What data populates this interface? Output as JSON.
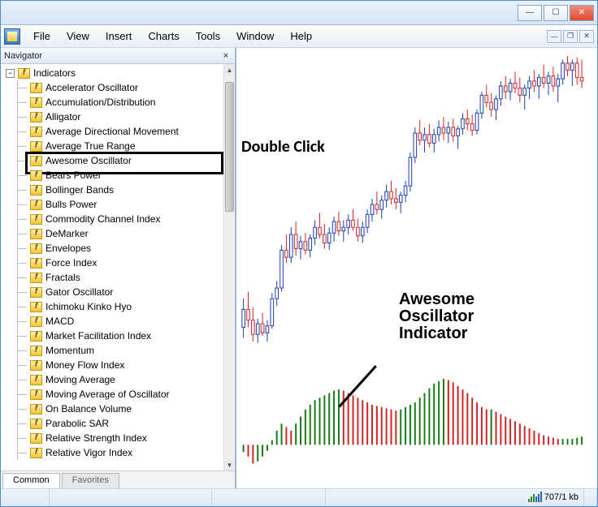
{
  "titlebar": {
    "min": "—",
    "max": "☐",
    "close": "✕"
  },
  "menu": {
    "items": [
      "File",
      "View",
      "Insert",
      "Charts",
      "Tools",
      "Window",
      "Help"
    ],
    "mdi": {
      "min": "—",
      "restore": "❐",
      "close": "✕"
    }
  },
  "navigator": {
    "title": "Navigator",
    "close": "×",
    "root": "Indicators",
    "items": [
      "Accelerator Oscillator",
      "Accumulation/Distribution",
      "Alligator",
      "Average Directional Movement",
      "Average True Range",
      "Awesome Oscillator",
      "Bears Power",
      "Bollinger Bands",
      "Bulls Power",
      "Commodity Channel Index",
      "DeMarker",
      "Envelopes",
      "Force Index",
      "Fractals",
      "Gator Oscillator",
      "Ichimoku Kinko Hyo",
      "MACD",
      "Market Facilitation Index",
      "Momentum",
      "Money Flow Index",
      "Moving Average",
      "Moving Average of Oscillator",
      "On Balance Volume",
      "Parabolic SAR",
      "Relative Strength Index",
      "Relative Vigor Index"
    ],
    "highlight_index": 5,
    "tabs": {
      "common": "Common",
      "favorites": "Favorites"
    }
  },
  "annotations": {
    "double_click": "Double Click",
    "indicator_line1": "Awesome",
    "indicator_line2": "Oscillator",
    "indicator_line3": "Indicator"
  },
  "status": {
    "connection": "707/1 kb"
  },
  "chart_data": {
    "type": "candlestick+histogram",
    "price_range": [
      1.0,
      1.04
    ],
    "candles_approx_count": 75,
    "oscillator_range": [
      -0.003,
      0.006
    ],
    "bar_count": 75,
    "colors": {
      "up": "#1a7d1a",
      "down": "#d22626",
      "wick": "#1c3fb5",
      "body_up": "#ffffff",
      "body_down": "#ffffff"
    },
    "candles": [
      {
        "x": 0,
        "o": 1.002,
        "h": 1.006,
        "l": 1.0005,
        "c": 1.0045
      },
      {
        "x": 1,
        "o": 1.0045,
        "h": 1.007,
        "l": 1.002,
        "c": 1.003
      },
      {
        "x": 2,
        "o": 1.003,
        "h": 1.0048,
        "l": 1.0,
        "c": 1.001
      },
      {
        "x": 3,
        "o": 1.001,
        "h": 1.0032,
        "l": 0.9998,
        "c": 1.0025
      },
      {
        "x": 4,
        "o": 1.0025,
        "h": 1.004,
        "l": 1.0008,
        "c": 1.0012
      },
      {
        "x": 5,
        "o": 1.0012,
        "h": 1.003,
        "l": 1.0,
        "c": 1.0022
      },
      {
        "x": 6,
        "o": 1.0022,
        "h": 1.0068,
        "l": 1.0018,
        "c": 1.006
      },
      {
        "x": 7,
        "o": 1.006,
        "h": 1.0085,
        "l": 1.005,
        "c": 1.0075
      },
      {
        "x": 8,
        "o": 1.0075,
        "h": 1.0135,
        "l": 1.007,
        "c": 1.0128
      },
      {
        "x": 9,
        "o": 1.0128,
        "h": 1.015,
        "l": 1.011,
        "c": 1.0118
      },
      {
        "x": 10,
        "o": 1.0118,
        "h": 1.016,
        "l": 1.011,
        "c": 1.015
      },
      {
        "x": 11,
        "o": 1.015,
        "h": 1.0168,
        "l": 1.012,
        "c": 1.013
      },
      {
        "x": 12,
        "o": 1.013,
        "h": 1.0148,
        "l": 1.0115,
        "c": 1.014
      },
      {
        "x": 13,
        "o": 1.014,
        "h": 1.0152,
        "l": 1.0122,
        "c": 1.0128
      },
      {
        "x": 14,
        "o": 1.0128,
        "h": 1.015,
        "l": 1.0118,
        "c": 1.0145
      },
      {
        "x": 15,
        "o": 1.0145,
        "h": 1.017,
        "l": 1.0135,
        "c": 1.016
      },
      {
        "x": 16,
        "o": 1.016,
        "h": 1.018,
        "l": 1.0145,
        "c": 1.015
      },
      {
        "x": 17,
        "o": 1.015,
        "h": 1.0165,
        "l": 1.013,
        "c": 1.0138
      },
      {
        "x": 18,
        "o": 1.0138,
        "h": 1.016,
        "l": 1.0128,
        "c": 1.0152
      },
      {
        "x": 19,
        "o": 1.0152,
        "h": 1.0175,
        "l": 1.014,
        "c": 1.0168
      },
      {
        "x": 20,
        "o": 1.0168,
        "h": 1.0182,
        "l": 1.0148,
        "c": 1.0155
      },
      {
        "x": 21,
        "o": 1.0155,
        "h": 1.017,
        "l": 1.014,
        "c": 1.016
      },
      {
        "x": 22,
        "o": 1.016,
        "h": 1.0178,
        "l": 1.015,
        "c": 1.017
      },
      {
        "x": 23,
        "o": 1.017,
        "h": 1.0185,
        "l": 1.0155,
        "c": 1.016
      },
      {
        "x": 24,
        "o": 1.016,
        "h": 1.0172,
        "l": 1.014,
        "c": 1.0148
      },
      {
        "x": 25,
        "o": 1.0148,
        "h": 1.0168,
        "l": 1.0138,
        "c": 1.016
      },
      {
        "x": 26,
        "o": 1.016,
        "h": 1.0185,
        "l": 1.0152,
        "c": 1.0178
      },
      {
        "x": 27,
        "o": 1.0178,
        "h": 1.02,
        "l": 1.0168,
        "c": 1.0192
      },
      {
        "x": 28,
        "o": 1.0192,
        "h": 1.021,
        "l": 1.0178,
        "c": 1.0185
      },
      {
        "x": 29,
        "o": 1.0185,
        "h": 1.0205,
        "l": 1.0172,
        "c": 1.0198
      },
      {
        "x": 30,
        "o": 1.0198,
        "h": 1.022,
        "l": 1.0188,
        "c": 1.021
      },
      {
        "x": 31,
        "o": 1.021,
        "h": 1.0225,
        "l": 1.0192,
        "c": 1.02
      },
      {
        "x": 32,
        "o": 1.02,
        "h": 1.0215,
        "l": 1.0185,
        "c": 1.0195
      },
      {
        "x": 33,
        "o": 1.0195,
        "h": 1.021,
        "l": 1.018,
        "c": 1.0205
      },
      {
        "x": 34,
        "o": 1.0205,
        "h": 1.0225,
        "l": 1.0195,
        "c": 1.0218
      },
      {
        "x": 35,
        "o": 1.0218,
        "h": 1.0265,
        "l": 1.021,
        "c": 1.0258
      },
      {
        "x": 36,
        "o": 1.0258,
        "h": 1.03,
        "l": 1.025,
        "c": 1.0292
      },
      {
        "x": 37,
        "o": 1.0292,
        "h": 1.031,
        "l": 1.0275,
        "c": 1.0282
      },
      {
        "x": 38,
        "o": 1.0282,
        "h": 1.03,
        "l": 1.0265,
        "c": 1.029
      },
      {
        "x": 39,
        "o": 1.029,
        "h": 1.0305,
        "l": 1.0272,
        "c": 1.0278
      },
      {
        "x": 40,
        "o": 1.0278,
        "h": 1.0298,
        "l": 1.0265,
        "c": 1.029
      },
      {
        "x": 41,
        "o": 1.029,
        "h": 1.031,
        "l": 1.028,
        "c": 1.03
      },
      {
        "x": 42,
        "o": 1.03,
        "h": 1.0315,
        "l": 1.0282,
        "c": 1.0292
      },
      {
        "x": 43,
        "o": 1.0292,
        "h": 1.0308,
        "l": 1.0278,
        "c": 1.03
      },
      {
        "x": 44,
        "o": 1.03,
        "h": 1.0312,
        "l": 1.028,
        "c": 1.0288
      },
      {
        "x": 45,
        "o": 1.0288,
        "h": 1.0302,
        "l": 1.027,
        "c": 1.0298
      },
      {
        "x": 46,
        "o": 1.0298,
        "h": 1.032,
        "l": 1.029,
        "c": 1.0312
      },
      {
        "x": 47,
        "o": 1.0312,
        "h": 1.0325,
        "l": 1.0296,
        "c": 1.0305
      },
      {
        "x": 48,
        "o": 1.0305,
        "h": 1.0318,
        "l": 1.0288,
        "c": 1.0296
      },
      {
        "x": 49,
        "o": 1.0296,
        "h": 1.0325,
        "l": 1.029,
        "c": 1.032
      },
      {
        "x": 50,
        "o": 1.032,
        "h": 1.035,
        "l": 1.0312,
        "c": 1.0345
      },
      {
        "x": 51,
        "o": 1.0345,
        "h": 1.036,
        "l": 1.0328,
        "c": 1.0335
      },
      {
        "x": 52,
        "o": 1.0335,
        "h": 1.0348,
        "l": 1.0315,
        "c": 1.0325
      },
      {
        "x": 53,
        "o": 1.0325,
        "h": 1.0345,
        "l": 1.031,
        "c": 1.034
      },
      {
        "x": 54,
        "o": 1.034,
        "h": 1.0365,
        "l": 1.033,
        "c": 1.0358
      },
      {
        "x": 55,
        "o": 1.0358,
        "h": 1.0372,
        "l": 1.034,
        "c": 1.035
      },
      {
        "x": 56,
        "o": 1.035,
        "h": 1.0368,
        "l": 1.0338,
        "c": 1.0362
      },
      {
        "x": 57,
        "o": 1.0362,
        "h": 1.0378,
        "l": 1.0348,
        "c": 1.0355
      },
      {
        "x": 58,
        "o": 1.0355,
        "h": 1.037,
        "l": 1.0335,
        "c": 1.0345
      },
      {
        "x": 59,
        "o": 1.0345,
        "h": 1.036,
        "l": 1.0325,
        "c": 1.0355
      },
      {
        "x": 60,
        "o": 1.0355,
        "h": 1.0372,
        "l": 1.034,
        "c": 1.0365
      },
      {
        "x": 61,
        "o": 1.0365,
        "h": 1.038,
        "l": 1.035,
        "c": 1.0358
      },
      {
        "x": 62,
        "o": 1.0358,
        "h": 1.0375,
        "l": 1.034,
        "c": 1.037
      },
      {
        "x": 63,
        "o": 1.037,
        "h": 1.0388,
        "l": 1.0355,
        "c": 1.0362
      },
      {
        "x": 64,
        "o": 1.0362,
        "h": 1.0378,
        "l": 1.0345,
        "c": 1.0372
      },
      {
        "x": 65,
        "o": 1.0372,
        "h": 1.0385,
        "l": 1.035,
        "c": 1.0358
      },
      {
        "x": 66,
        "o": 1.0358,
        "h": 1.0375,
        "l": 1.0335,
        "c": 1.0368
      },
      {
        "x": 67,
        "o": 1.0368,
        "h": 1.0395,
        "l": 1.036,
        "c": 1.039
      },
      {
        "x": 68,
        "o": 1.039,
        "h": 1.04,
        "l": 1.0372,
        "c": 1.038
      },
      {
        "x": 69,
        "o": 1.038,
        "h": 1.0395,
        "l": 1.0358,
        "c": 1.039
      },
      {
        "x": 70,
        "o": 1.039,
        "h": 1.0398,
        "l": 1.036,
        "c": 1.037
      },
      {
        "x": 71,
        "o": 1.037,
        "h": 1.0395,
        "l": 1.0355,
        "c": 1.0365
      }
    ],
    "oscillator": [
      -0.0006,
      -0.001,
      -0.0016,
      -0.0014,
      -0.001,
      -0.0005,
      0.0004,
      0.0012,
      0.0018,
      0.0015,
      0.0012,
      0.0018,
      0.0024,
      0.003,
      0.0034,
      0.0038,
      0.004,
      0.0042,
      0.0044,
      0.0046,
      0.0047,
      0.0046,
      0.0044,
      0.0042,
      0.004,
      0.0038,
      0.0036,
      0.0034,
      0.0033,
      0.0032,
      0.0031,
      0.003,
      0.0029,
      0.003,
      0.0032,
      0.0034,
      0.0036,
      0.004,
      0.0044,
      0.0048,
      0.0052,
      0.0054,
      0.0056,
      0.0055,
      0.0053,
      0.005,
      0.0047,
      0.0044,
      0.004,
      0.0036,
      0.0032,
      0.003,
      0.003,
      0.0028,
      0.0026,
      0.0024,
      0.0022,
      0.002,
      0.0018,
      0.0016,
      0.0014,
      0.0012,
      0.001,
      0.0008,
      0.0007,
      0.0006,
      0.0005,
      0.0005,
      0.0005,
      0.0005,
      0.0006,
      0.0007
    ]
  }
}
